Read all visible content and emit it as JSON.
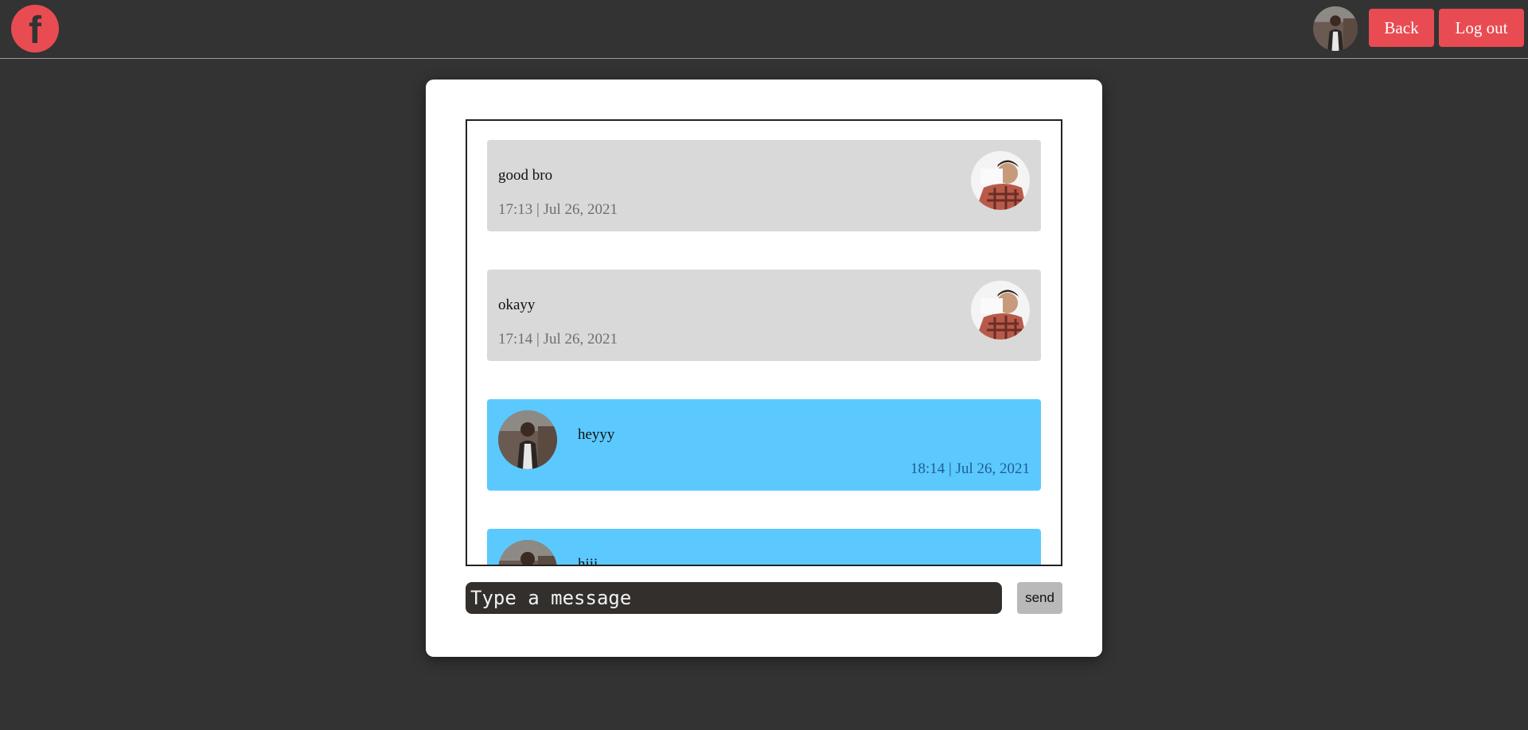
{
  "header": {
    "logo_letter": "f",
    "back_label": "Back",
    "logout_label": "Log out"
  },
  "messages": [
    {
      "text": "good bro",
      "time": "17:13 | Jul 26, 2021",
      "direction": "incoming"
    },
    {
      "text": "okayy",
      "time": "17:14 | Jul 26, 2021",
      "direction": "incoming"
    },
    {
      "text": "heyyy",
      "time": "18:14 | Jul 26, 2021",
      "direction": "outgoing"
    },
    {
      "text": "hiii",
      "time": "",
      "direction": "outgoing"
    }
  ],
  "composer": {
    "placeholder": "Type a message",
    "send_label": "send"
  },
  "colors": {
    "background": "#333333",
    "accent": "#e84c52",
    "incoming_bubble": "#d9d9d9",
    "outgoing_bubble": "#5bc9fe"
  }
}
